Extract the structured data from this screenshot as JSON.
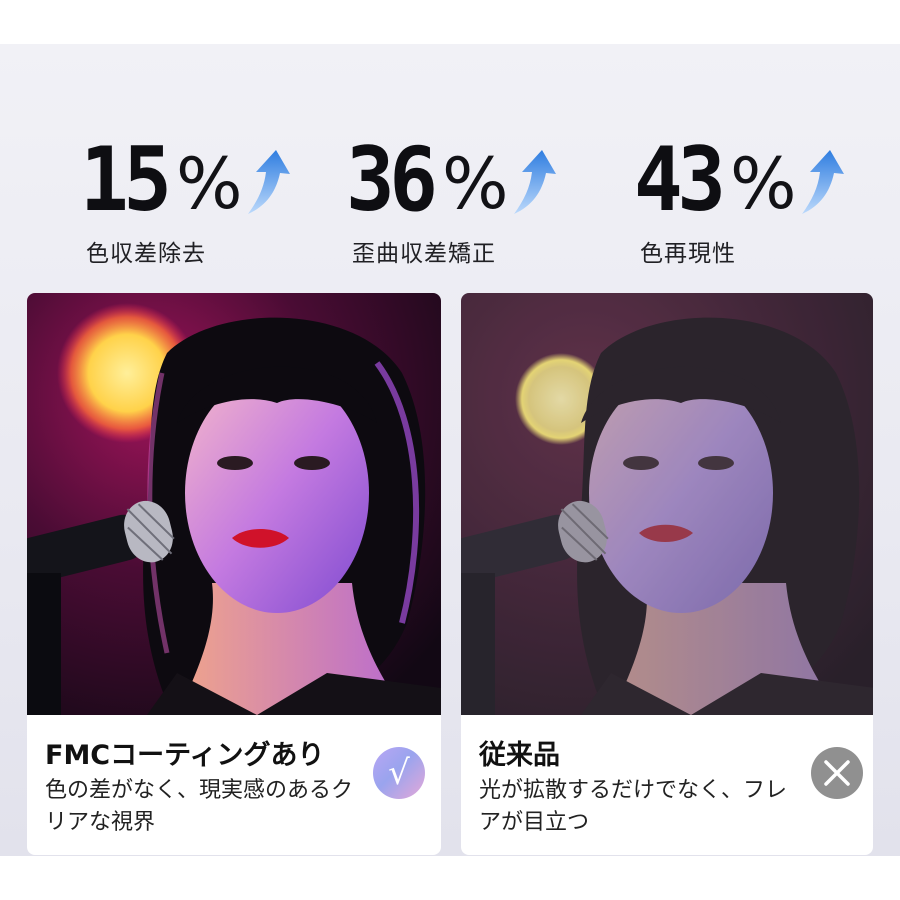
{
  "stats": [
    {
      "number": "15",
      "unit": "%",
      "label": "色収差除去",
      "arrow_icon": "up-arrow-icon"
    },
    {
      "number": "36",
      "unit": "%",
      "label": "歪曲収差矯正",
      "arrow_icon": "up-arrow-icon"
    },
    {
      "number": "43",
      "unit": "%",
      "label": "色再現性",
      "arrow_icon": "up-arrow-icon"
    }
  ],
  "cards": [
    {
      "title": "FMCコーティングあり",
      "description": "色の差がなく、現実感のあるクリアな視界",
      "icon": "check-icon",
      "icon_glyph": "√"
    },
    {
      "title": "従来品",
      "description": "光が拡散するだけでなく、フレアが目立つ",
      "icon": "cross-icon"
    }
  ],
  "colors": {
    "background": "#ececf3",
    "arrow_gradient": [
      "#2f7de0",
      "#b7d6fb"
    ],
    "check_badge": "#b0a4f0",
    "cross_badge": "#909090"
  }
}
